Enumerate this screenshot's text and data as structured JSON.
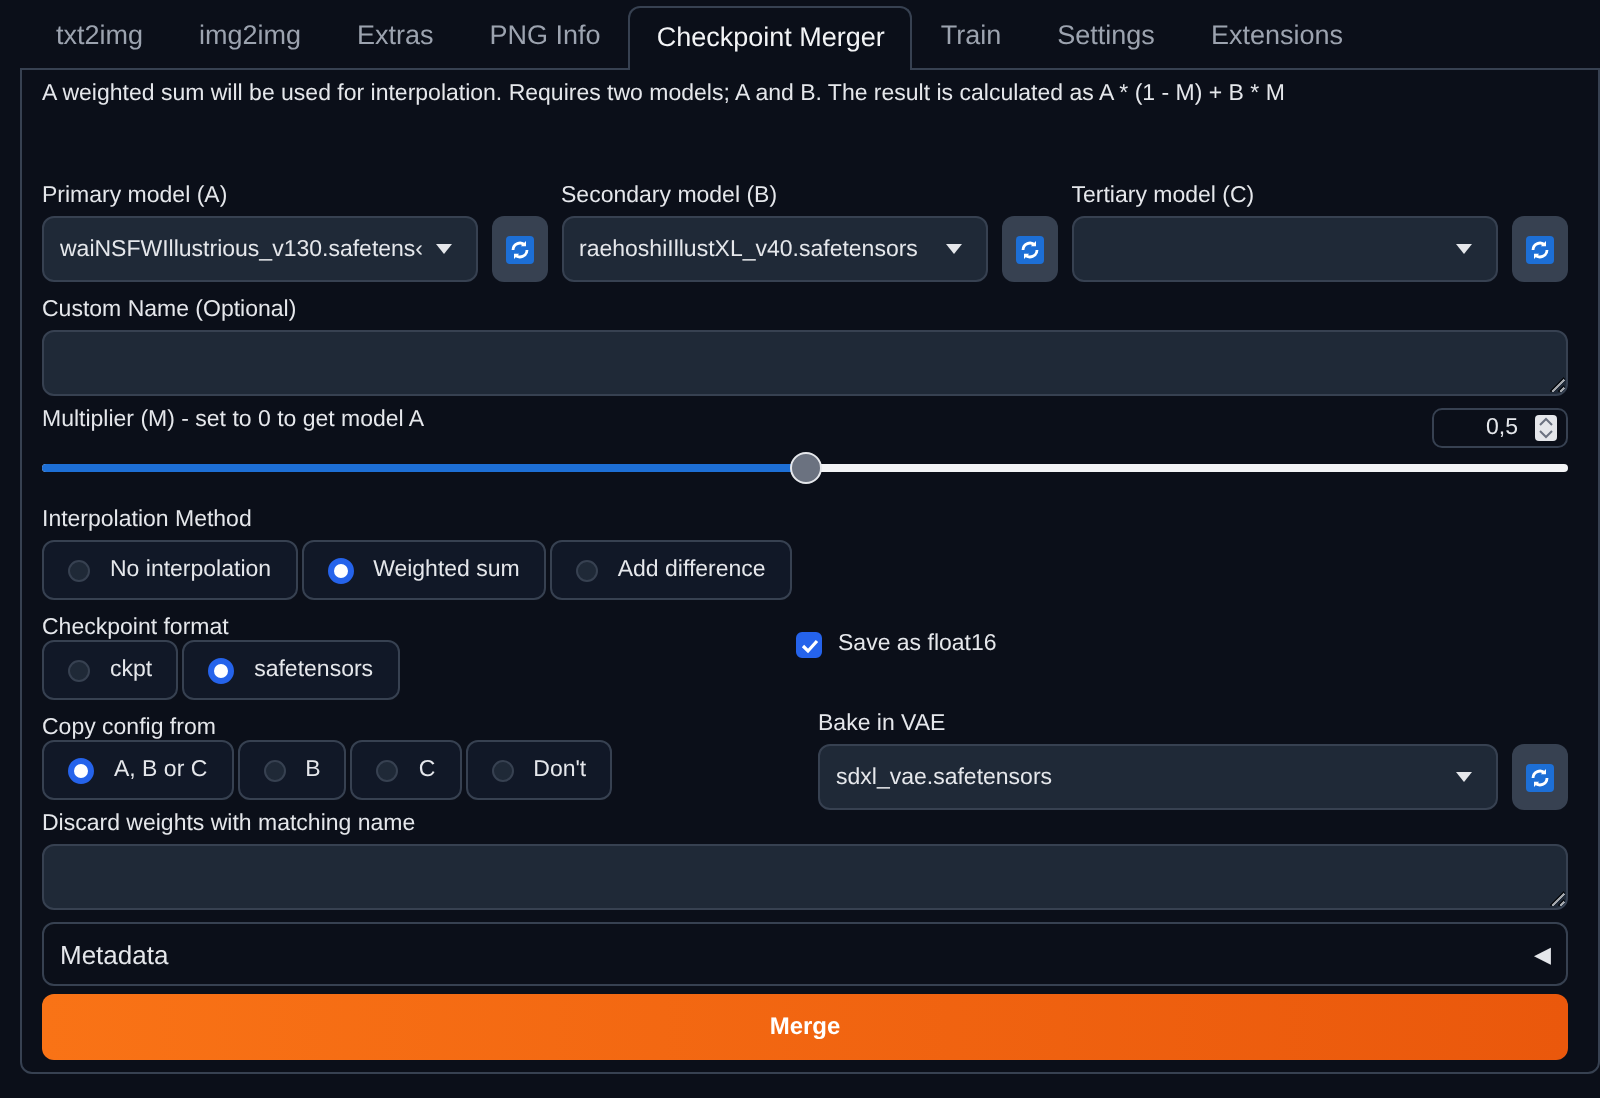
{
  "tabs": [
    {
      "label": "txt2img",
      "selected": false
    },
    {
      "label": "img2img",
      "selected": false
    },
    {
      "label": "Extras",
      "selected": false
    },
    {
      "label": "PNG Info",
      "selected": false
    },
    {
      "label": "Checkpoint Merger",
      "selected": true
    },
    {
      "label": "Train",
      "selected": false
    },
    {
      "label": "Settings",
      "selected": false
    },
    {
      "label": "Extensions",
      "selected": false
    }
  ],
  "description": "A weighted sum will be used for interpolation. Requires two models; A and B. The result is calculated as A * (1 - M) + B * M",
  "models": [
    {
      "label": "Primary model (A)",
      "value": "waiNSFWIllustrious_v130.safetens‹"
    },
    {
      "label": "Secondary model (B)",
      "value": "raehoshiIllustXL_v40.safetensors"
    },
    {
      "label": "Tertiary model (C)"
    }
  ],
  "custom_name": {
    "label": "Custom Name (Optional)"
  },
  "multiplier": {
    "label": "Multiplier (M) - set to 0 to get model A",
    "value": "0,5",
    "level": 0.5
  },
  "interpolation": {
    "label": "Interpolation Method",
    "options": [
      {
        "label": "No interpolation",
        "selected": false
      },
      {
        "label": "Weighted sum",
        "selected": true
      },
      {
        "label": "Add difference",
        "selected": false
      }
    ]
  },
  "checkpoint_format": {
    "label": "Checkpoint format",
    "options": [
      {
        "label": "ckpt",
        "selected": false
      },
      {
        "label": "safetensors",
        "selected": true
      }
    ]
  },
  "save_float16": {
    "label": "Save as float16",
    "checked": true
  },
  "copy_config": {
    "label": "Copy config from",
    "options": [
      {
        "label": "A, B or C",
        "selected": true
      },
      {
        "label": "B",
        "selected": false
      },
      {
        "label": "C",
        "selected": false
      },
      {
        "label": "Don't",
        "selected": false
      }
    ]
  },
  "bake_vae": {
    "label": "Bake in VAE",
    "value": "sdxl_vae.safetensors"
  },
  "discard": {
    "label": "Discard weights with matching name"
  },
  "metadata": {
    "label": "Metadata",
    "toggle": "◀"
  },
  "merge_button": "Merge"
}
